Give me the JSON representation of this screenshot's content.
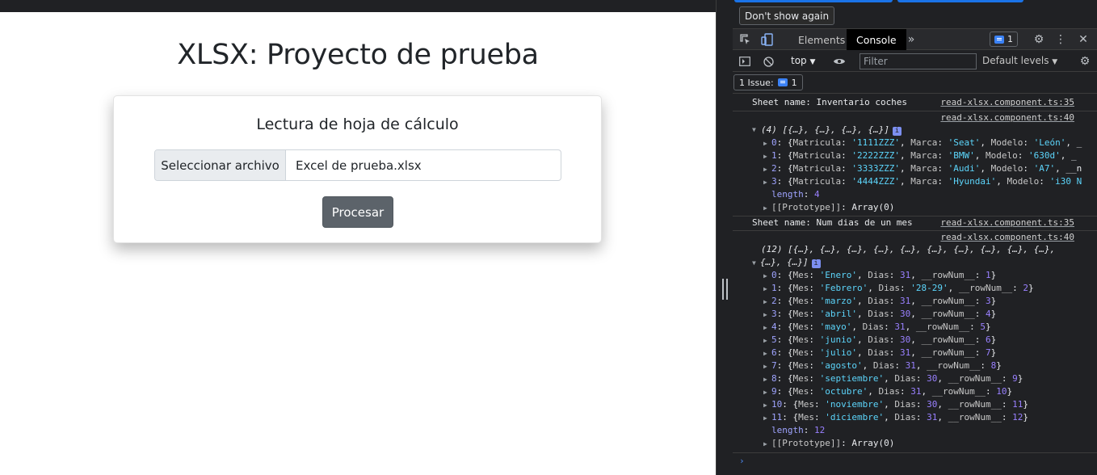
{
  "page": {
    "title": "XLSX: Proyecto de prueba",
    "card_title": "Lectura de hoja de cálculo",
    "file_button": "Seleccionar archivo",
    "file_name": "Excel de prueba.xlsx",
    "process_button": "Procesar"
  },
  "devtools": {
    "dont_show_again": "Don't show again",
    "tabs": {
      "elements": "Elements",
      "console": "Console"
    },
    "issues_badge_count": "1",
    "context": "top",
    "filter_placeholder": "Filter",
    "levels": "Default levels",
    "issue_pill": {
      "label": "1 Issue:",
      "count": "1"
    },
    "logs": {
      "sheet1": {
        "text": "Sheet name: Inventario coches",
        "src": "read-xlsx.component.ts:35"
      },
      "arr1_src": "read-xlsx.component.ts:40",
      "arr1_header": "(4) [{…}, {…}, {…}, {…}]",
      "cars": [
        {
          "i": "0",
          "matricula": "'1111ZZZ'",
          "marca": "'Seat'",
          "modelo": "'León'",
          "tail": ", _"
        },
        {
          "i": "1",
          "matricula": "'2222ZZZ'",
          "marca": "'BMW'",
          "modelo": "'630d'",
          "tail": ", _"
        },
        {
          "i": "2",
          "matricula": "'3333ZZZ'",
          "marca": "'Audi'",
          "modelo": "'A7'",
          "tail": ", __n"
        },
        {
          "i": "3",
          "matricula": "'4444ZZZ'",
          "marca": "'Hyundai'",
          "modelo": "'i30 N",
          "tail": ""
        }
      ],
      "arr1_length": "4",
      "prototype": "Array(0)",
      "sheet2": {
        "text": "Sheet name: Num dias de un mes",
        "src": "read-xlsx.component.ts:35"
      },
      "arr2_src": "read-xlsx.component.ts:40",
      "arr2_header_line1": "(12) [{…}, {…}, {…}, {…}, {…}, {…}, {…}, {…}, {…}, {…},",
      "arr2_header_line2": "{…}, {…}]",
      "months": [
        {
          "i": "0",
          "mes": "'Enero'",
          "dias": "31",
          "num": "1"
        },
        {
          "i": "1",
          "mes": "'Febrero'",
          "dias": "'28-29'",
          "num": "2"
        },
        {
          "i": "2",
          "mes": "'marzo'",
          "dias": "31",
          "num": "3"
        },
        {
          "i": "3",
          "mes": "'abril'",
          "dias": "30",
          "num": "4"
        },
        {
          "i": "4",
          "mes": "'mayo'",
          "dias": "31",
          "num": "5"
        },
        {
          "i": "5",
          "mes": "'junio'",
          "dias": "30",
          "num": "6"
        },
        {
          "i": "6",
          "mes": "'julio'",
          "dias": "31",
          "num": "7"
        },
        {
          "i": "7",
          "mes": "'agosto'",
          "dias": "31",
          "num": "8"
        },
        {
          "i": "8",
          "mes": "'septiembre'",
          "dias": "30",
          "num": "9"
        },
        {
          "i": "9",
          "mes": "'octubre'",
          "dias": "31",
          "num": "10"
        },
        {
          "i": "10",
          "mes": "'noviembre'",
          "dias": "30",
          "num": "11"
        },
        {
          "i": "11",
          "mes": "'diciembre'",
          "dias": "31",
          "num": "12"
        }
      ],
      "arr2_length": "12"
    }
  },
  "colors": {
    "accent": "#1a73e8",
    "button": "#5c636a",
    "string": "#5cd5fb",
    "number": "#9980ff",
    "key": "#9fa4ff"
  }
}
